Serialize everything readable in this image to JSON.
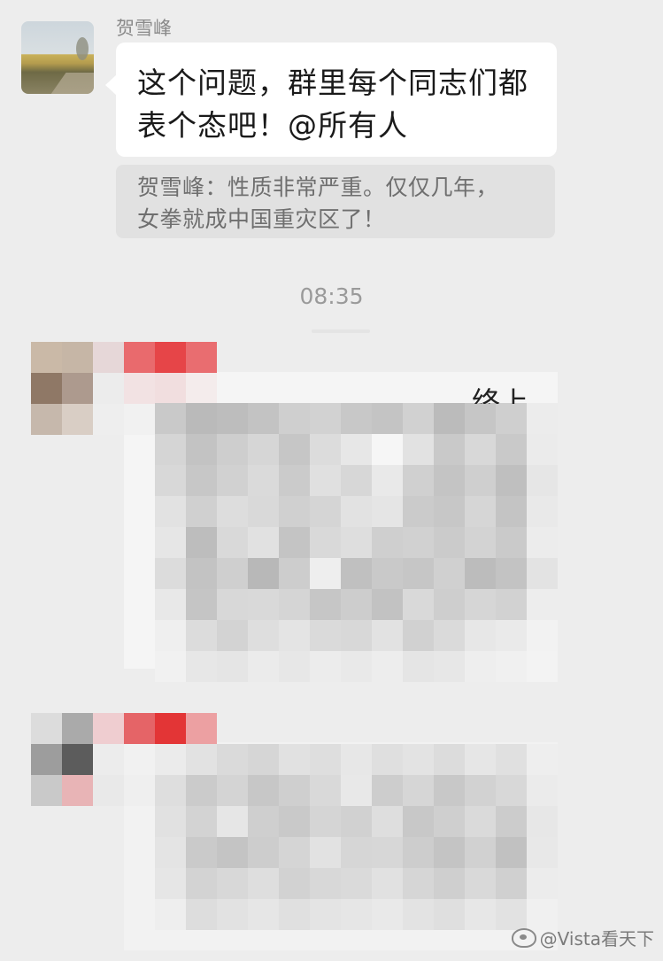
{
  "message": {
    "sender_name": "贺雪峰",
    "text_line1": "这个问题，群里每个同志们都",
    "text_line2": "表个态吧！@所有人",
    "quote_line1": "贺雪峰：性质非常严重。仅仅几年，",
    "quote_line2": "女拳就成中国重灾区了！"
  },
  "timestamp": "08:35",
  "pixelated": {
    "partial_text": "终上",
    "block1_colors": [
      [
        "#c9c9c9",
        "#bababa",
        "#bdbdbd",
        "#c3c3c3",
        "#cfcfcf",
        "#d2d2d2",
        "#c8c8c8",
        "#c4c4c4",
        "#d1d1d1",
        "#bbbbbb",
        "#c6c6c6",
        "#cfcfcf",
        "#ececec"
      ],
      [
        "#d5d5d5",
        "#c3c3c3",
        "#cecece",
        "#d6d6d6",
        "#c6c6c6",
        "#dcdcdc",
        "#e7e7e7",
        "#f6f6f6",
        "#e2e2e2",
        "#c9c9c9",
        "#d8d8d8",
        "#c9c9c9",
        "#ebebeb"
      ],
      [
        "#d8d8d8",
        "#c7c7c7",
        "#d1d1d1",
        "#dadada",
        "#cbcbcb",
        "#e0e0e0",
        "#d7d7d7",
        "#e9e9e9",
        "#d0d0d0",
        "#c4c4c4",
        "#cfcfcf",
        "#bfbfbf",
        "#e6e6e6"
      ],
      [
        "#e2e2e2",
        "#d0d0d0",
        "#dddddd",
        "#d9d9d9",
        "#d0d0d0",
        "#d5d5d5",
        "#e2e2e2",
        "#e5e5e5",
        "#cbcbcb",
        "#c7c7c7",
        "#d6d6d6",
        "#c4c4c4",
        "#e9e9e9"
      ],
      [
        "#e6e6e6",
        "#bdbdbd",
        "#d9d9d9",
        "#e1e1e1",
        "#c4c4c4",
        "#d9d9d9",
        "#dedede",
        "#cfcfcf",
        "#d1d1d1",
        "#cbcbcb",
        "#d3d3d3",
        "#cacaca",
        "#ececec"
      ],
      [
        "#dcdcdc",
        "#c3c3c3",
        "#cfcfcf",
        "#b8b8b8",
        "#cdcdcd",
        "#eeeeee",
        "#c0c0c0",
        "#c9c9c9",
        "#c6c6c6",
        "#d0d0d0",
        "#bcbcbc",
        "#c3c3c3",
        "#e3e3e3"
      ],
      [
        "#e8e8e8",
        "#c5c5c5",
        "#d8d8d8",
        "#d9d9d9",
        "#d5d5d5",
        "#c6c6c6",
        "#cdcdcd",
        "#c2c2c2",
        "#d9d9d9",
        "#cecece",
        "#d6d6d6",
        "#d2d2d2",
        "#ededed"
      ],
      [
        "#efefef",
        "#dcdcdc",
        "#d3d3d3",
        "#dedede",
        "#e4e4e4",
        "#dadada",
        "#d8d8d8",
        "#e2e2e2",
        "#d1d1d1",
        "#dadada",
        "#e7e7e7",
        "#eaeaea",
        "#f2f2f2"
      ],
      [
        "#f1f1f1",
        "#e7e7e7",
        "#e5e5e5",
        "#ebebeb",
        "#e7e7e7",
        "#ececec",
        "#e9e9e9",
        "#ededed",
        "#e5e5e5",
        "#e7e7e7",
        "#eeeeee",
        "#f0f0f0",
        "#f3f3f3"
      ]
    ],
    "block2_colors": [
      [
        "#ebebeb",
        "#e2e2e2",
        "#dadada",
        "#d6d6d6",
        "#e1e1e1",
        "#dedede",
        "#e7e7e7",
        "#dfdfdf",
        "#e3e3e3",
        "#dcdcdc",
        "#e6e6e6",
        "#e0e0e0",
        "#eeeeee"
      ],
      [
        "#dedede",
        "#cbcbcb",
        "#d4d4d4",
        "#c7c7c7",
        "#cfcfcf",
        "#d9d9d9",
        "#e8e8e8",
        "#cdcdcd",
        "#d6d6d6",
        "#c8c8c8",
        "#d2d2d2",
        "#d8d8d8",
        "#ebebeb"
      ],
      [
        "#e1e1e1",
        "#d3d3d3",
        "#e6e6e6",
        "#cfcfcf",
        "#c9c9c9",
        "#d5d5d5",
        "#d1d1d1",
        "#dedede",
        "#c8c8c8",
        "#cfcfcf",
        "#dadada",
        "#cccccc",
        "#e7e7e7"
      ],
      [
        "#e4e4e4",
        "#cacaca",
        "#c4c4c4",
        "#cdcdcd",
        "#d5d5d5",
        "#e2e2e2",
        "#d6d6d6",
        "#d7d7d7",
        "#cdcdcd",
        "#c4c4c4",
        "#d1d1d1",
        "#c1c1c1",
        "#e8e8e8"
      ],
      [
        "#e6e6e6",
        "#d3d3d3",
        "#d8d8d8",
        "#dedede",
        "#d2d2d2",
        "#d8d8d8",
        "#dadada",
        "#e1e1e1",
        "#d6d6d6",
        "#cfcfcf",
        "#d9d9d9",
        "#d0d0d0",
        "#ececec"
      ],
      [
        "#eeeeee",
        "#dddddd",
        "#e2e2e2",
        "#e6e6e6",
        "#e0e0e0",
        "#e4e4e4",
        "#e6e6e6",
        "#e9e9e9",
        "#e3e3e3",
        "#dfdfdf",
        "#e7e7e7",
        "#e2e2e2",
        "#f0f0f0"
      ]
    ],
    "avatar1_colors": [
      [
        "#cab9a7",
        "#c6b6a6",
        "#e6d7d8",
        "#e96a6d",
        "#e64548",
        "#e96d70"
      ],
      [
        "#8f7866",
        "#ad9a8e",
        "#ececec",
        "#f2e2e3",
        "#f1dedf",
        "#f4ecec"
      ],
      [
        "#c6b8ac",
        "#d9cec5",
        "#eeeeee",
        "#f1f1f1",
        "#efefef",
        "#f2f2f2"
      ]
    ],
    "avatar2_colors": [
      [
        "#dcdcdc",
        "#aaaaaa",
        "#efcdd0",
        "#e56467",
        "#e33536",
        "#eca0a2"
      ],
      [
        "#9d9d9d",
        "#5c5c5c",
        "#ececec",
        "#f1f1f1",
        "#eeeeee",
        "#f2f2f2"
      ],
      [
        "#c9c9c9",
        "#e8b4b6",
        "#e9e9e9",
        "#efefef",
        "#eeeeee",
        "#f0f0f0"
      ]
    ]
  },
  "watermark": {
    "text": "@Vista看天下",
    "icon": "weibo-logo-icon"
  }
}
